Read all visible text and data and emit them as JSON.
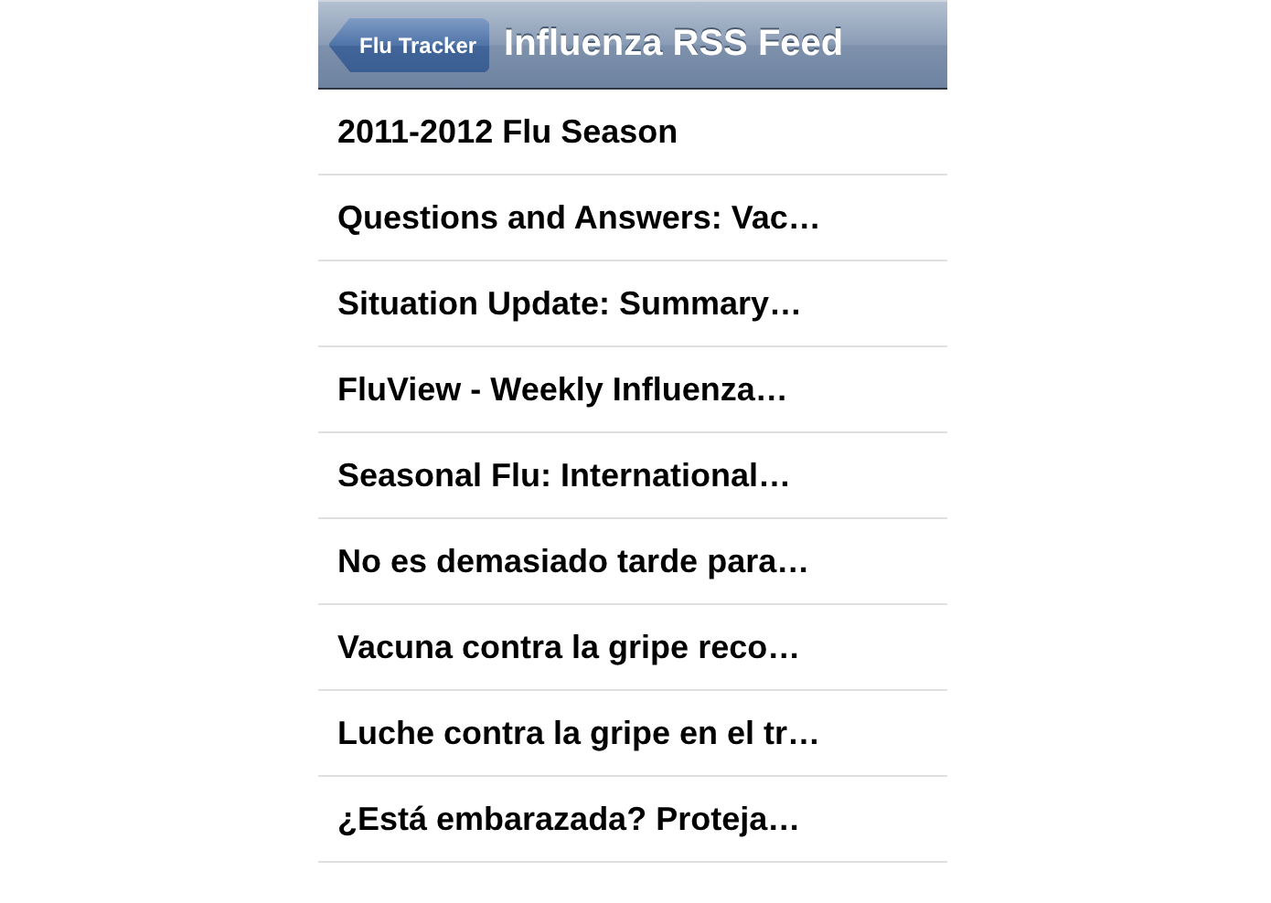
{
  "nav_bar": {
    "back_button": "Flu Tracker",
    "title": "Influenza RSS Feed"
  },
  "items": [
    "2011-2012 Flu Season",
    "Questions and Answers: Vac…",
    "Situation Update: Summary…",
    "FluView - Weekly Influenza…",
    "Seasonal Flu: International…",
    "No es demasiado tarde para…",
    "Vacuna contra la gripe reco…",
    "Luche contra la gripe en el tr…",
    "¿Está embarazada? Proteja…"
  ]
}
